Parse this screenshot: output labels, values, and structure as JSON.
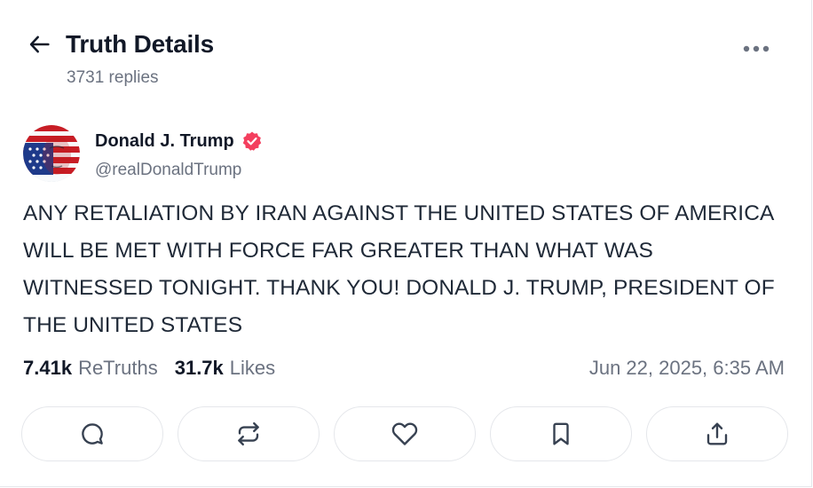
{
  "header": {
    "title": "Truth Details",
    "replies": "3731 replies"
  },
  "author": {
    "name": "Donald J. Trump",
    "handle": "@realDonaldTrump",
    "verified": true,
    "verified_color": "#f43f5e"
  },
  "post": {
    "text": "ANY RETALIATION BY IRAN AGAINST THE UNITED STATES OF AMERICA WILL BE MET WITH FORCE FAR GREATER THAN WHAT WAS WITNESSED TONIGHT. THANK YOU! DONALD J. TRUMP, PRESIDENT OF THE UNITED STATES"
  },
  "stats": {
    "retruths_count": "7.41k",
    "retruths_label": "ReTruths",
    "likes_count": "31.7k",
    "likes_label": "Likes",
    "timestamp": "Jun 22, 2025, 6:35 AM"
  },
  "actions": [
    "reply-icon",
    "retruth-icon",
    "heart-icon",
    "bookmark-icon",
    "share-icon"
  ],
  "icons": {
    "back": "arrow-left-icon",
    "more": "more-horizontal-icon"
  }
}
